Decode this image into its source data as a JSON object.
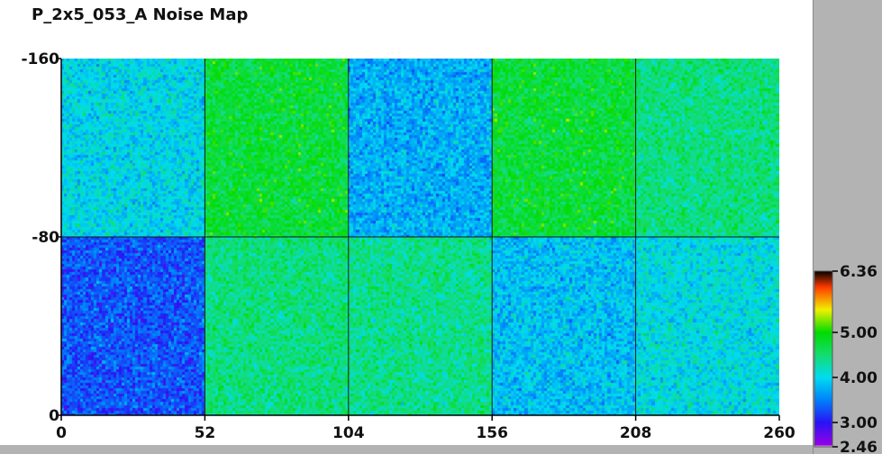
{
  "title": "P_2x5_053_A Noise Map",
  "chart_data": {
    "type": "heatmap",
    "title": "P_2x5_053_A Noise Map",
    "xlim": [
      0,
      260
    ],
    "ylim": [
      0,
      160
    ],
    "x_ticks": [
      "0",
      "52",
      "104",
      "156",
      "208",
      "260"
    ],
    "y_ticks": [
      "0",
      "-80",
      "-160"
    ],
    "y_tick_values": [
      0,
      80,
      160
    ],
    "x_tick_values": [
      0,
      52,
      104,
      156,
      208,
      260
    ],
    "grid": true,
    "regions": [
      {
        "x": [
          0,
          52
        ],
        "y": [
          80,
          160
        ],
        "mean": 4.0
      },
      {
        "x": [
          52,
          104
        ],
        "y": [
          80,
          160
        ],
        "mean": 4.75
      },
      {
        "x": [
          104,
          156
        ],
        "y": [
          80,
          160
        ],
        "mean": 3.75
      },
      {
        "x": [
          156,
          208
        ],
        "y": [
          80,
          160
        ],
        "mean": 4.75
      },
      {
        "x": [
          208,
          260
        ],
        "y": [
          80,
          160
        ],
        "mean": 4.45
      },
      {
        "x": [
          0,
          52
        ],
        "y": [
          0,
          80
        ],
        "mean": 3.3
      },
      {
        "x": [
          52,
          104
        ],
        "y": [
          0,
          80
        ],
        "mean": 4.45
      },
      {
        "x": [
          104,
          156
        ],
        "y": [
          0,
          80
        ],
        "mean": 4.4
      },
      {
        "x": [
          156,
          208
        ],
        "y": [
          0,
          80
        ],
        "mean": 3.85
      },
      {
        "x": [
          208,
          260
        ],
        "y": [
          0,
          80
        ],
        "mean": 4.05
      }
    ],
    "colorscale": {
      "min": 2.46,
      "max": 6.36,
      "labels": [
        "6.36",
        "5.00",
        "4.00",
        "3.00",
        "2.46"
      ],
      "label_values": [
        6.36,
        5.0,
        4.0,
        3.0,
        2.46
      ]
    }
  }
}
